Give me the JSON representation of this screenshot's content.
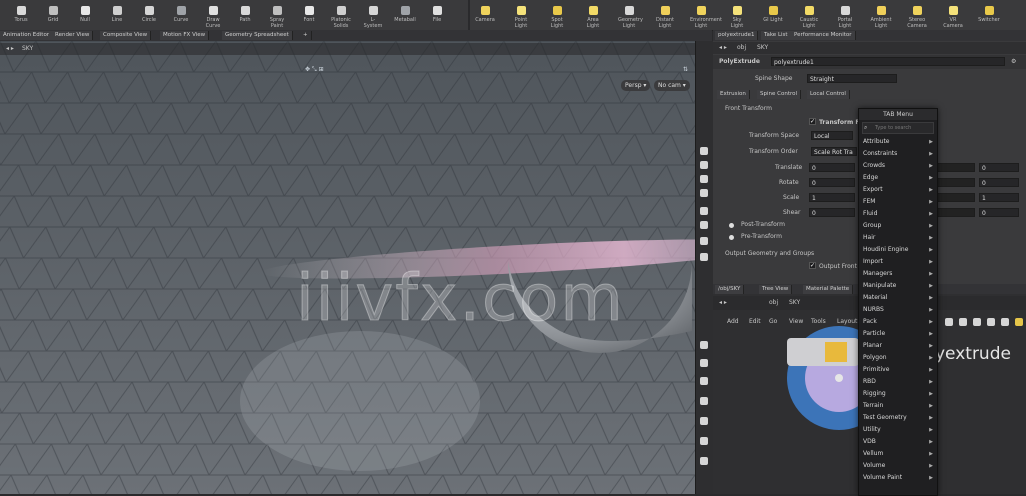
{
  "shelf_left": {
    "tools": [
      {
        "label": "Torus",
        "icon": "torus-icon"
      },
      {
        "label": "Grid",
        "icon": "grid-icon"
      },
      {
        "label": "Null",
        "icon": "null-icon"
      },
      {
        "label": "Line",
        "icon": "line-icon"
      },
      {
        "label": "Circle",
        "icon": "circle-icon"
      },
      {
        "label": "Curve",
        "icon": "curve-icon"
      },
      {
        "label": "Draw Curve",
        "icon": "draw-curve-icon"
      },
      {
        "label": "Path",
        "icon": "path-icon"
      },
      {
        "label": "Spray Paint",
        "icon": "spray-paint-icon"
      },
      {
        "label": "Font",
        "icon": "font-icon"
      },
      {
        "label": "Platonic Solids",
        "icon": "platonic-icon"
      },
      {
        "label": "L-System",
        "icon": "lsystem-icon"
      },
      {
        "label": "Metaball",
        "icon": "metaball-icon"
      },
      {
        "label": "File",
        "icon": "file-icon"
      }
    ]
  },
  "shelf_right": {
    "tools": [
      {
        "label": "Camera",
        "icon": "camera-icon"
      },
      {
        "label": "Point Light",
        "icon": "point-light-icon"
      },
      {
        "label": "Spot Light",
        "icon": "spot-light-icon"
      },
      {
        "label": "Area Light",
        "icon": "area-light-icon"
      },
      {
        "label": "Geometry Light",
        "icon": "geometry-light-icon"
      },
      {
        "label": "Distant Light",
        "icon": "distant-light-icon"
      },
      {
        "label": "Environment Light",
        "icon": "env-light-icon"
      },
      {
        "label": "Sky Light",
        "icon": "sky-light-icon"
      },
      {
        "label": "GI Light",
        "icon": "gi-light-icon"
      },
      {
        "label": "Caustic Light",
        "icon": "caustic-light-icon"
      },
      {
        "label": "Portal Light",
        "icon": "portal-light-icon"
      },
      {
        "label": "Ambient Light",
        "icon": "ambient-light-icon"
      },
      {
        "label": "Stereo Camera",
        "icon": "stereo-camera-icon"
      },
      {
        "label": "VR Camera",
        "icon": "vr-camera-icon"
      },
      {
        "label": "Switcher",
        "icon": "switcher-icon"
      }
    ]
  },
  "pane_tabs_left": [
    "Animation Editor",
    "Render View",
    "Composite View",
    "Motion FX View",
    "Geometry Spreadsheet"
  ],
  "viewport": {
    "path": "SKY",
    "persp": "Persp ▾",
    "cam": "No cam ▾"
  },
  "pane_tabs_right": [
    "polyextrude1",
    "Take List",
    "Performance Monitor"
  ],
  "params": {
    "path_obj": "obj",
    "path_node": "SKY",
    "node_type": "PolyExtrude",
    "node_name": "polyextrude1",
    "spine_shape_label": "Spine Shape",
    "spine_shape_value": "Straight",
    "tabs": [
      "Extrusion",
      "Spine Control",
      "Local Control"
    ],
    "front_transform": "Front Transform",
    "transform_front": "Transform F",
    "transform_space_label": "Transform Space",
    "transform_space_value": "Local",
    "transform_order_label": "Transform Order",
    "transform_order_value": "Scale Rot Tra",
    "rows": [
      {
        "label": "Translate",
        "v1": "0",
        "v3": "0"
      },
      {
        "label": "Rotate",
        "v1": "0",
        "v3": "0"
      },
      {
        "label": "Scale",
        "v1": "1",
        "v3": "1"
      },
      {
        "label": "Shear",
        "v1": "0",
        "v3": "0"
      }
    ],
    "post_transform": "Post-Transform",
    "pre_transform": "Pre-Transform",
    "output_geo": "Output Geometry and Groups",
    "output_front": "Output Front"
  },
  "net": {
    "tabs": [
      "/obj/SKY",
      "Tree View",
      "Material Palette"
    ],
    "path_obj": "obj",
    "path_node": "SKY",
    "menu": [
      "Add",
      "Edit",
      "Go",
      "View",
      "Tools",
      "Layout"
    ],
    "node_label": "yextrude"
  },
  "tab_menu": {
    "title": "TAB Menu",
    "search_placeholder": "Type to search",
    "items": [
      "Attribute",
      "Constraints",
      "Crowds",
      "Edge",
      "Export",
      "FEM",
      "Fluid",
      "Group",
      "Hair",
      "Houdini Engine",
      "Import",
      "Managers",
      "Manipulate",
      "Material",
      "NURBS",
      "Pack",
      "Particle",
      "Planar",
      "Polygon",
      "Primitive",
      "RBD",
      "Rigging",
      "Terrain",
      "Test Geometry",
      "Utility",
      "VDB",
      "Vellum",
      "Volume",
      "Volume Paint"
    ]
  },
  "watermark": "iiivfx.com"
}
